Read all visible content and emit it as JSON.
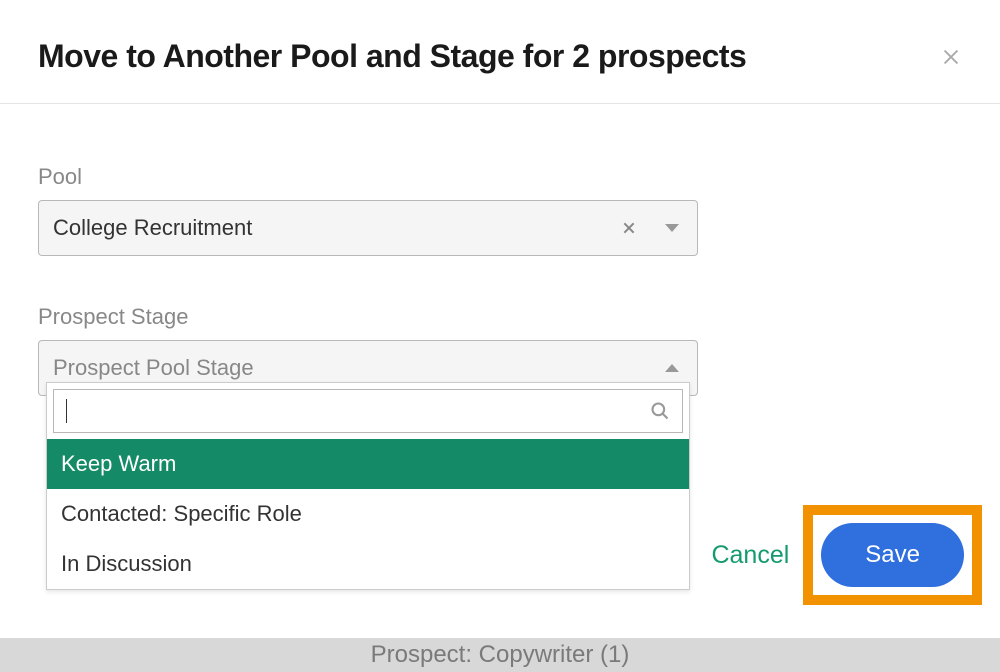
{
  "modal": {
    "title": "Move to Another Pool and Stage for 2 prospects"
  },
  "pool": {
    "label": "Pool",
    "selected": "College Recruitment"
  },
  "stage": {
    "label": "Prospect Stage",
    "placeholder": "Prospect Pool Stage",
    "search_value": "",
    "options": [
      "Keep Warm",
      "Contacted: Specific Role",
      "In Discussion"
    ]
  },
  "actions": {
    "cancel": "Cancel",
    "save": "Save"
  },
  "background": {
    "strip_text": "Prospect: Copywriter (1)"
  }
}
